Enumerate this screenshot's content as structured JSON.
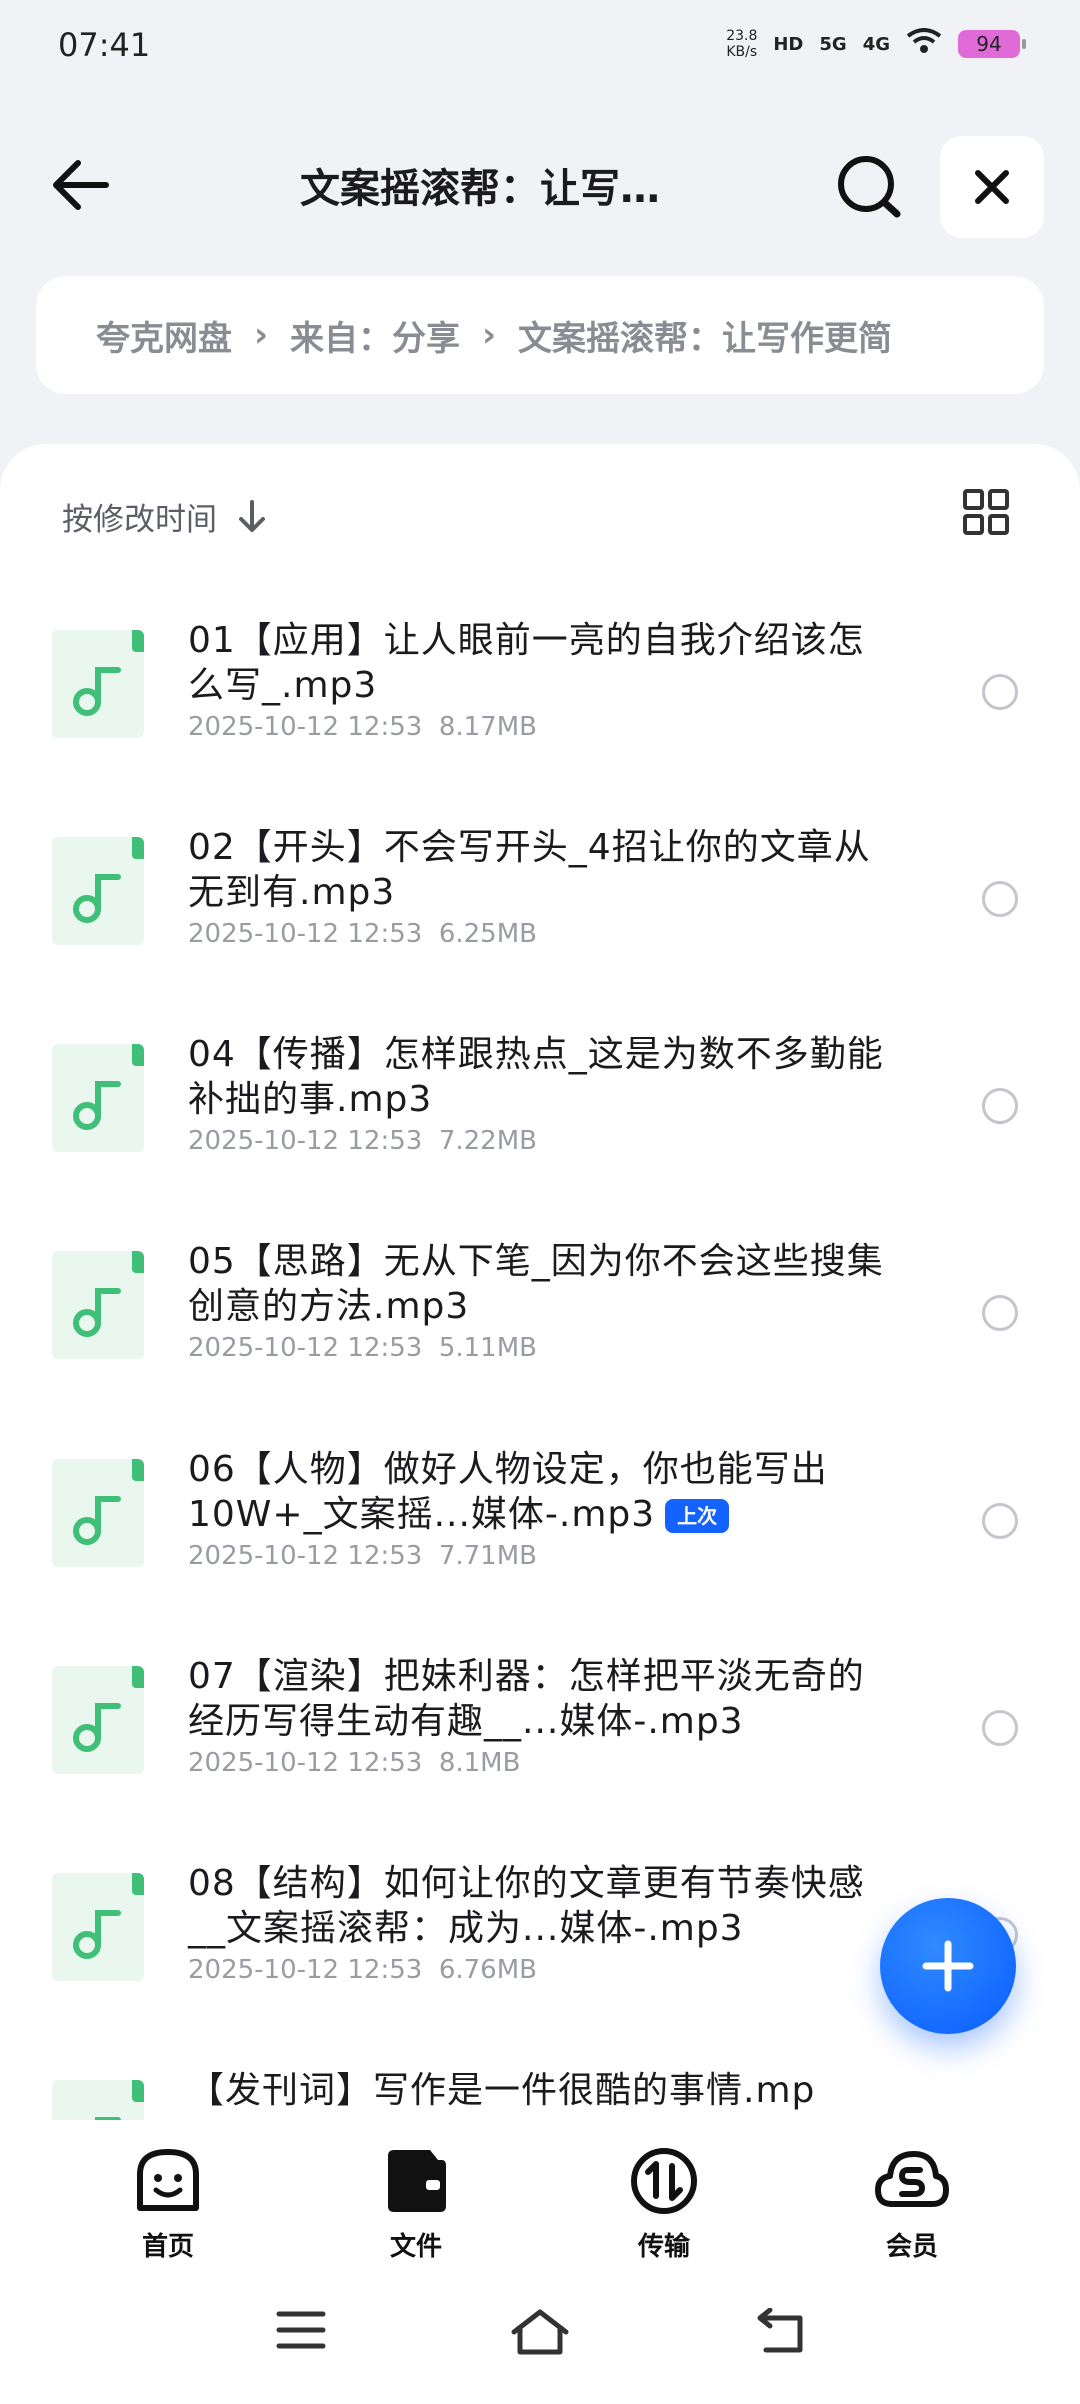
{
  "status": {
    "time": "07:41",
    "speed_value": "23.8",
    "speed_unit": "KB/s",
    "hd": "HD",
    "net1": "5G",
    "net2": "4G",
    "battery": "94"
  },
  "header": {
    "title": "文案摇滚帮：让写…",
    "breadcrumb": [
      "夸克网盘",
      "来自：分享",
      "文案摇滚帮：让写作更简"
    ]
  },
  "sort": {
    "label": "按修改时间"
  },
  "files": [
    {
      "name": "01【应用】让人眼前一亮的自我介绍该怎么写_.mp3",
      "date": "2025-10-12 12:53",
      "size": "8.17MB"
    },
    {
      "name": "02【开头】不会写开头_4招让你的文章从无到有.mp3",
      "date": "2025-10-12 12:53",
      "size": "6.25MB"
    },
    {
      "name": "04【传播】怎样跟热点_这是为数不多勤能补拙的事.mp3",
      "date": "2025-10-12 12:53",
      "size": "7.22MB"
    },
    {
      "name": "05【思路】无从下笔_因为你不会这些搜集创意的方法.mp3",
      "date": "2025-10-12 12:53",
      "size": "5.11MB"
    },
    {
      "name": "06【人物】做好人物设定，你也能写出10W+_文案摇...媒体-.mp3",
      "date": "2025-10-12 12:53",
      "size": "7.71MB",
      "badge": "上次"
    },
    {
      "name": "07【渲染】把妹利器：怎样把平淡无奇的经历写得生动有趣__...媒体-.mp3",
      "date": "2025-10-12 12:53",
      "size": "8.1MB"
    },
    {
      "name": "08【结构】如何让你的文章更有节奏快感__文案摇滚帮：成为...媒体-.mp3",
      "date": "2025-10-12 12:53",
      "size": "6.76MB"
    },
    {
      "name": "【发刊词】写作是一件很酷的事情.mp",
      "date": "",
      "size": ""
    }
  ],
  "tabs": [
    {
      "label": "首页"
    },
    {
      "label": "文件"
    },
    {
      "label": "传输"
    },
    {
      "label": "会员"
    }
  ],
  "colors": {
    "accent": "#1462ff",
    "file_icon": "#3fbf78"
  }
}
